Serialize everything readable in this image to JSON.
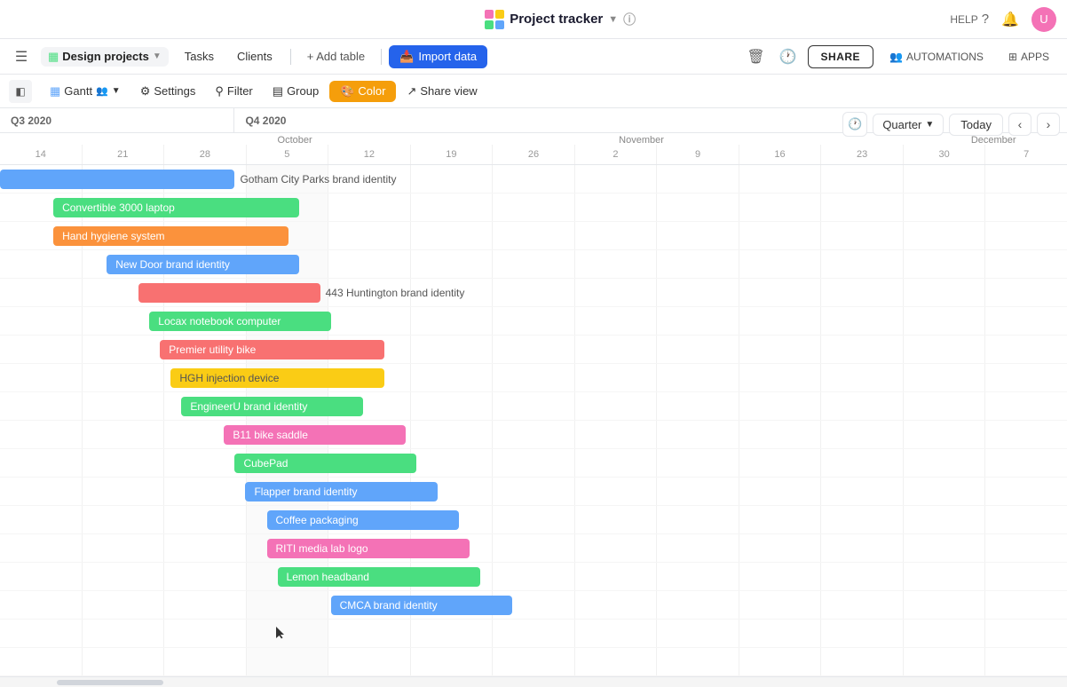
{
  "app": {
    "logo_colors": [
      "#f472b6",
      "#facc15",
      "#4ade80",
      "#60a5fa"
    ],
    "title": "Project tracker",
    "info_tooltip": "info"
  },
  "topbar": {
    "help_label": "HELP",
    "user_avatar_initials": "U"
  },
  "toolbar": {
    "menu_icon": "☰",
    "table_name": "Design projects",
    "tabs": [
      {
        "id": "tasks",
        "label": "Tasks"
      },
      {
        "id": "clients",
        "label": "Clients"
      }
    ],
    "add_table_label": "+ Add table",
    "import_label": "Import data",
    "share_label": "SHARE",
    "automations_label": "AUTOMATIONS",
    "apps_label": "APPS"
  },
  "view_toolbar": {
    "view_name": "Gantt",
    "settings_label": "Settings",
    "filter_label": "Filter",
    "group_label": "Group",
    "color_label": "Color",
    "share_view_label": "Share view"
  },
  "timeline": {
    "q3_label": "Q3 2020",
    "q4_label": "Q4 2020",
    "months": [
      {
        "label": "October",
        "pos_pct": 26
      },
      {
        "label": "November",
        "pos_pct": 58
      },
      {
        "label": "December",
        "pos_pct": 91
      }
    ],
    "dates": [
      "14",
      "21",
      "28",
      "5",
      "12",
      "19",
      "26",
      "2",
      "9",
      "16",
      "23",
      "30",
      "7"
    ]
  },
  "nav": {
    "quarter_selector": "Quarter",
    "today_btn": "Today"
  },
  "bars": [
    {
      "id": "gotham",
      "label": "Gotham City Parks brand identity",
      "color": "#60a5fa",
      "left_pct": 0,
      "width_pct": 24,
      "text_offset": 105
    },
    {
      "id": "convertible",
      "label": "Convertible 3000 laptop",
      "color": "#4ade80",
      "left_pct": 5,
      "width_pct": 16,
      "text_offset": 0
    },
    {
      "id": "hand-hygiene",
      "label": "Hand hygiene system",
      "color": "#fb923c",
      "left_pct": 5,
      "width_pct": 18,
      "text_offset": 0
    },
    {
      "id": "new-door",
      "label": "New Door brand identity",
      "color": "#60a5fa",
      "left_pct": 9,
      "width_pct": 15,
      "text_offset": 0
    },
    {
      "id": "443-huntington",
      "label": "443 Huntington brand identity",
      "color": "#f87171",
      "left_pct": 13,
      "width_pct": 15,
      "text_offset": 105
    },
    {
      "id": "locax",
      "label": "Locax notebook computer",
      "color": "#4ade80",
      "left_pct": 14,
      "width_pct": 15,
      "text_offset": 0
    },
    {
      "id": "premier",
      "label": "Premier utility bike",
      "color": "#f87171",
      "left_pct": 15,
      "width_pct": 18,
      "text_offset": 0
    },
    {
      "id": "hgh",
      "label": "HGH injection device",
      "color": "#facc15",
      "left_pct": 16,
      "width_pct": 18,
      "text_offset": 0
    },
    {
      "id": "engineeru",
      "label": "EngineerU brand identity",
      "color": "#4ade80",
      "left_pct": 17,
      "width_pct": 15,
      "text_offset": 0
    },
    {
      "id": "b11",
      "label": "B11 bike saddle",
      "color": "#f472b6",
      "left_pct": 20,
      "width_pct": 16,
      "text_offset": 0
    },
    {
      "id": "cubepad",
      "label": "CubePad",
      "color": "#4ade80",
      "left_pct": 21,
      "width_pct": 16,
      "text_offset": 0
    },
    {
      "id": "flapper",
      "label": "Flapper brand identity",
      "color": "#60a5fa",
      "left_pct": 22,
      "width_pct": 17,
      "text_offset": 0
    },
    {
      "id": "coffee",
      "label": "Coffee packaging",
      "color": "#60a5fa",
      "left_pct": 24,
      "width_pct": 16,
      "text_offset": 0
    },
    {
      "id": "riti",
      "label": "RITI media lab logo",
      "color": "#f472b6",
      "left_pct": 24,
      "width_pct": 16,
      "text_offset": 0
    },
    {
      "id": "lemon",
      "label": "Lemon headband",
      "color": "#4ade80",
      "left_pct": 25,
      "width_pct": 16,
      "text_offset": 0
    },
    {
      "id": "cmca",
      "label": "CMCA brand identity",
      "color": "#60a5fa",
      "left_pct": 29,
      "width_pct": 15,
      "text_offset": 0
    }
  ]
}
